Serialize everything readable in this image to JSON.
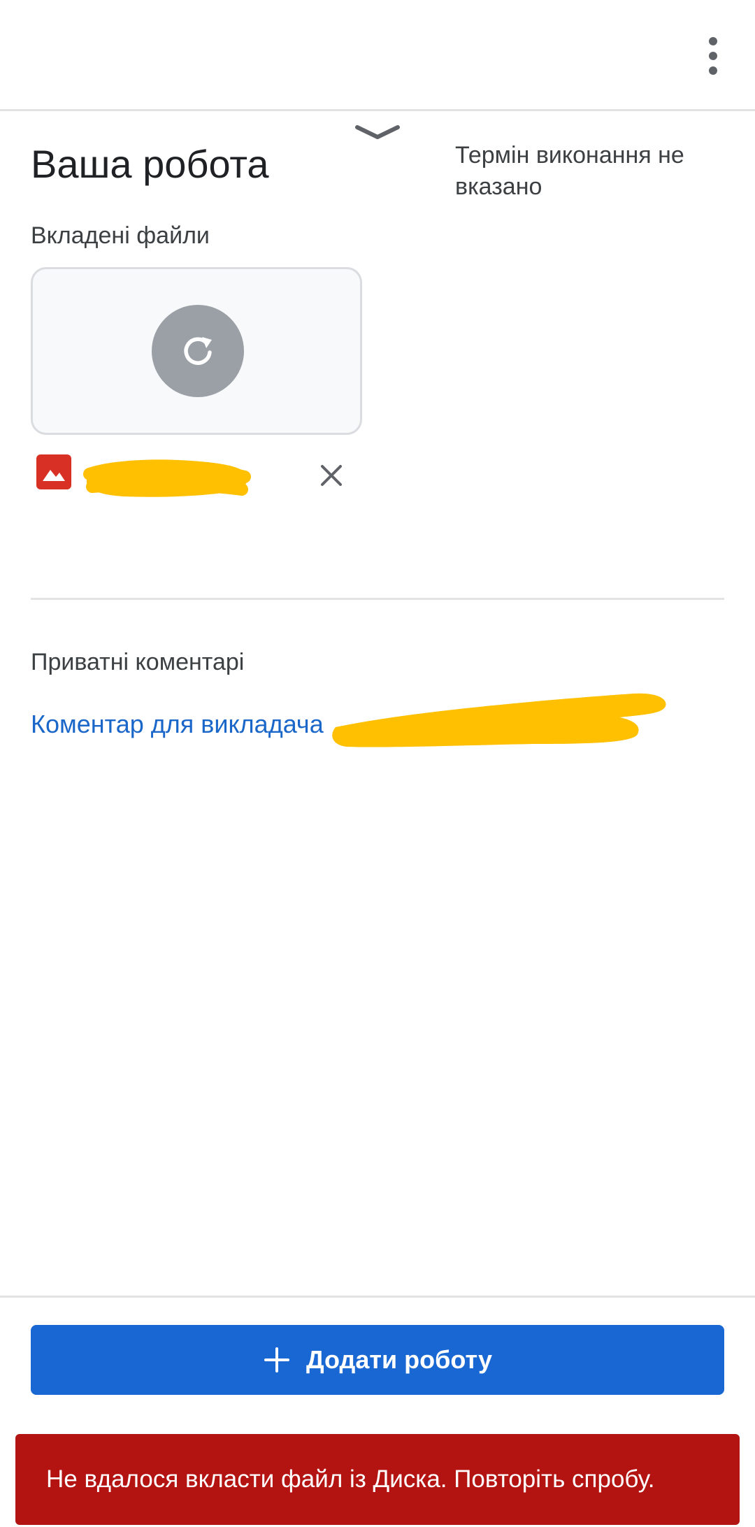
{
  "appbar": {
    "more_icon": "more-vert-icon"
  },
  "handle": {
    "icon": "chevron-down-icon"
  },
  "work": {
    "title": "Ваша робота",
    "due_status": "Термін виконання не вказано"
  },
  "attachments": {
    "label": "Вкладені файли",
    "preview_icon": "refresh-icon",
    "file": {
      "type_icon": "image-icon",
      "name": "",
      "remove_icon": "close-icon"
    }
  },
  "private_comments": {
    "label": "Приватні коментарі",
    "link": "Коментар для викладача"
  },
  "actions": {
    "add_work_label": "Додати роботу",
    "add_icon": "plus-icon"
  },
  "snackbar": {
    "message": "Не вдалося вкласти файл із Диска. Повторіть спробу."
  },
  "colors": {
    "primary": "#1967d2",
    "link": "#1a67c9",
    "error": "#b31412",
    "file_icon": "#d93025",
    "redaction": "#fec000"
  }
}
